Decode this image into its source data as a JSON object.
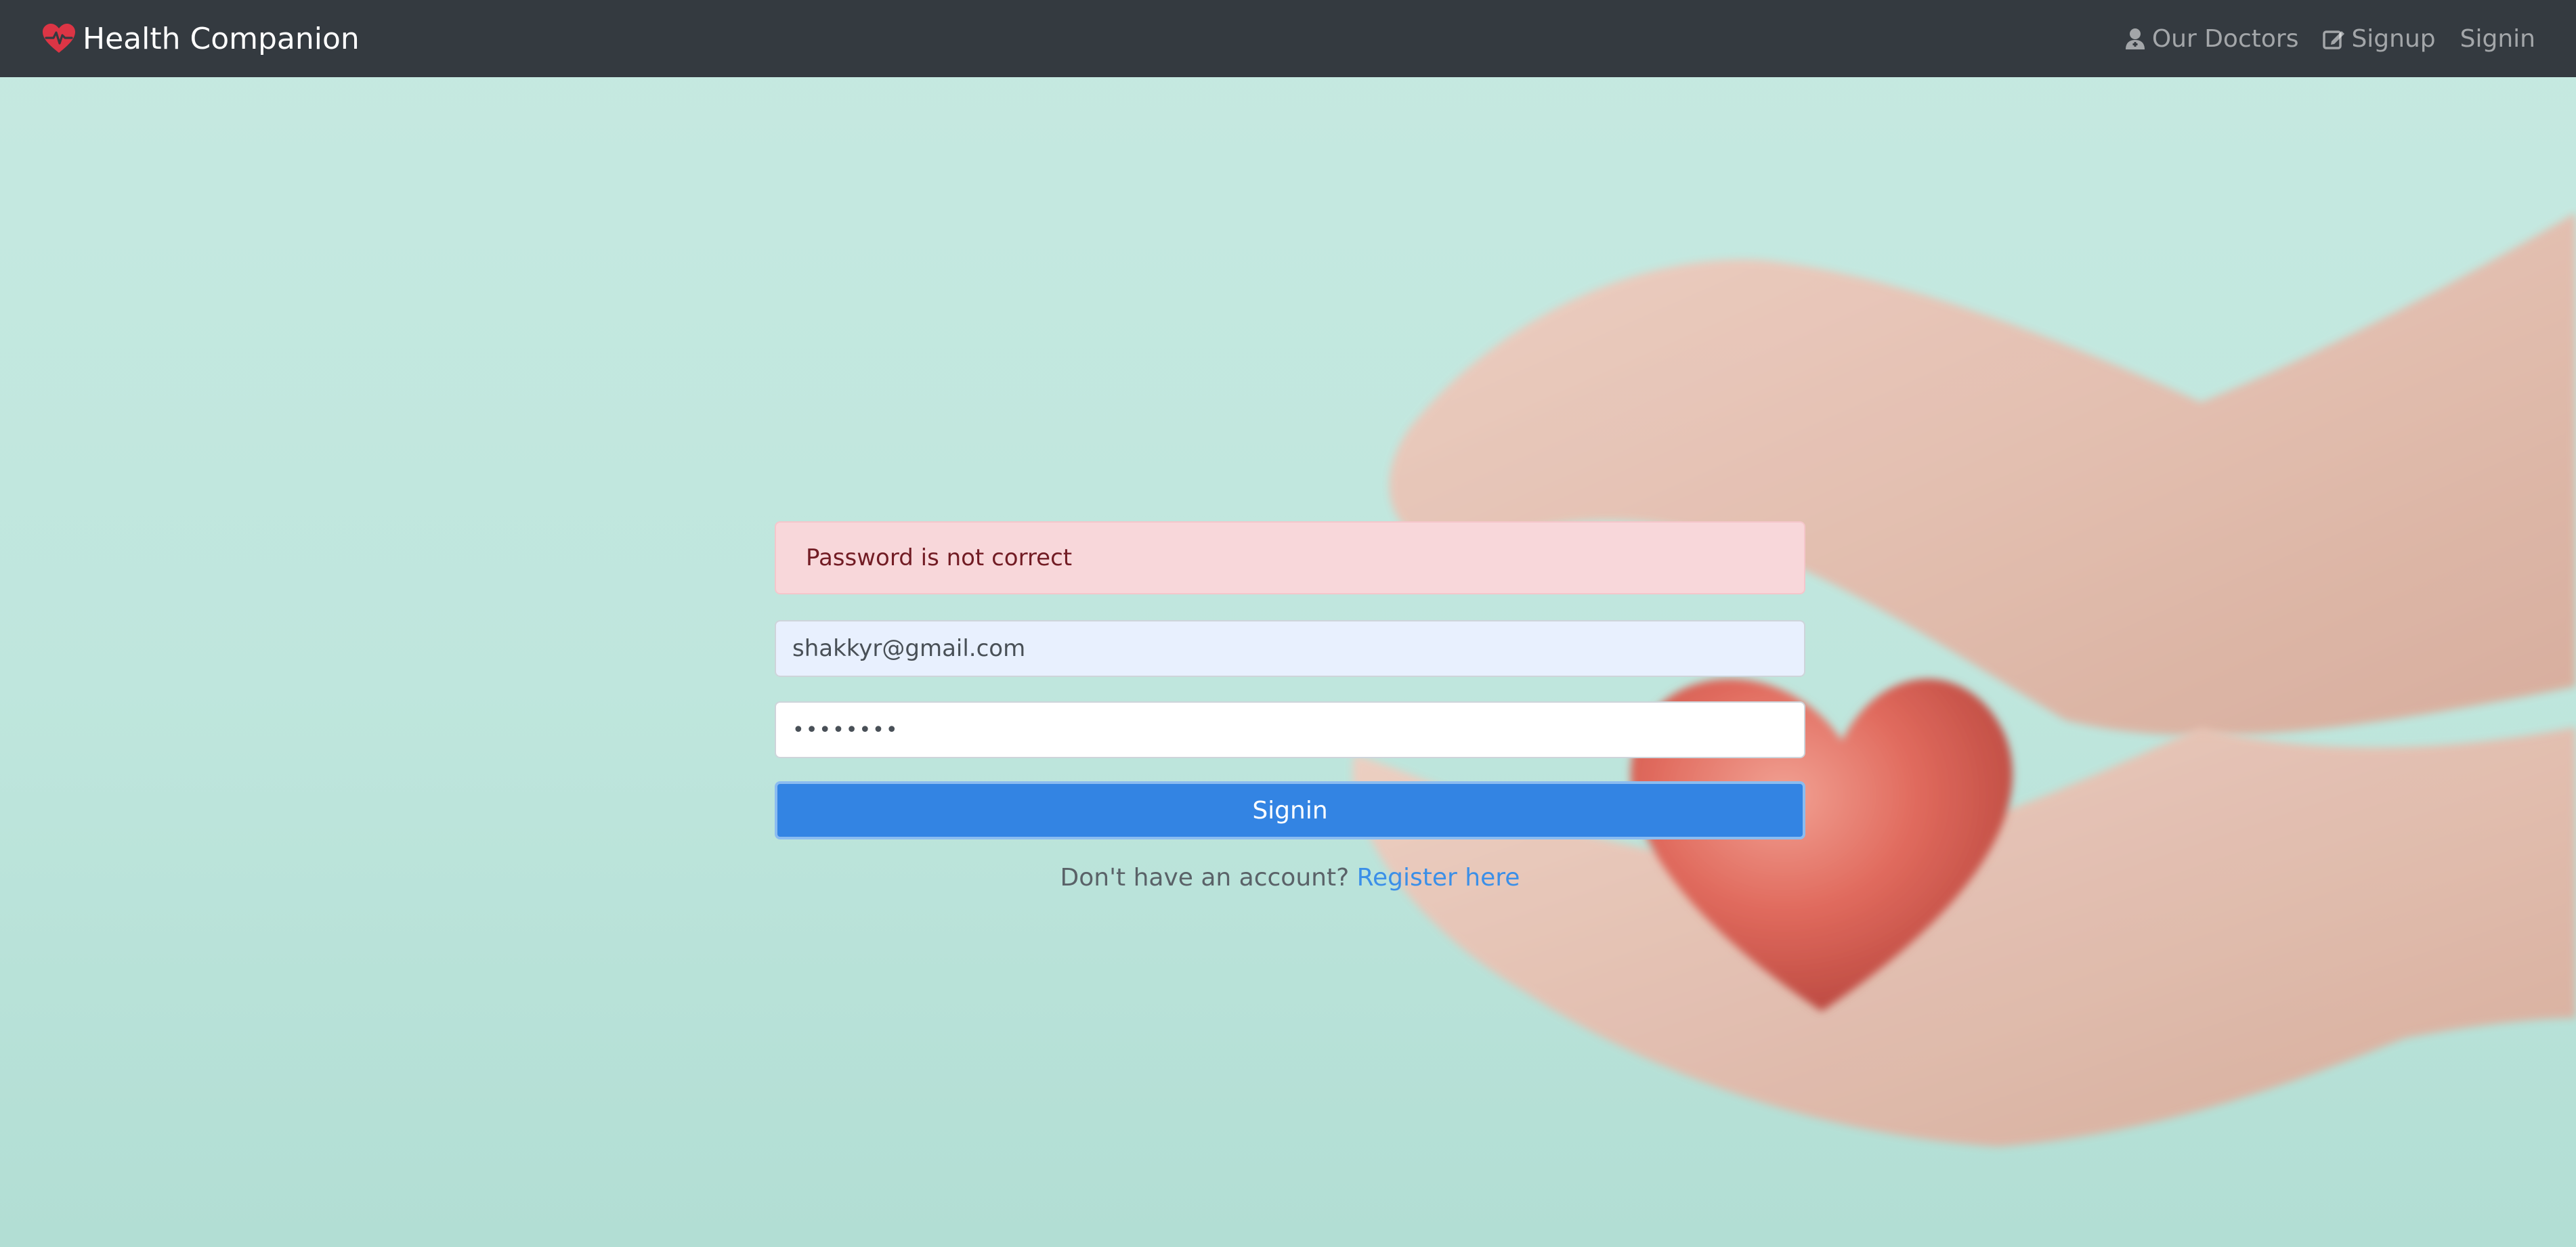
{
  "navbar": {
    "brand": "Health Companion",
    "links": [
      {
        "label": "Our Doctors",
        "icon": "user-doctor-icon"
      },
      {
        "label": "Signup",
        "icon": "edit-icon"
      },
      {
        "label": "Signin",
        "icon": ""
      }
    ]
  },
  "form": {
    "alert": "Password is not correct",
    "email_value": "shakkyr@gmail.com",
    "password_value": "••••••••",
    "signin_label": "Signin",
    "register_prompt": "Don't have an account?",
    "register_link": "Register here"
  },
  "colors": {
    "navbar_bg": "#343a40",
    "brand_heart": "#dc3545",
    "primary": "#3384e3",
    "alert_bg": "#f8d7da",
    "background": "#c2e7df"
  }
}
